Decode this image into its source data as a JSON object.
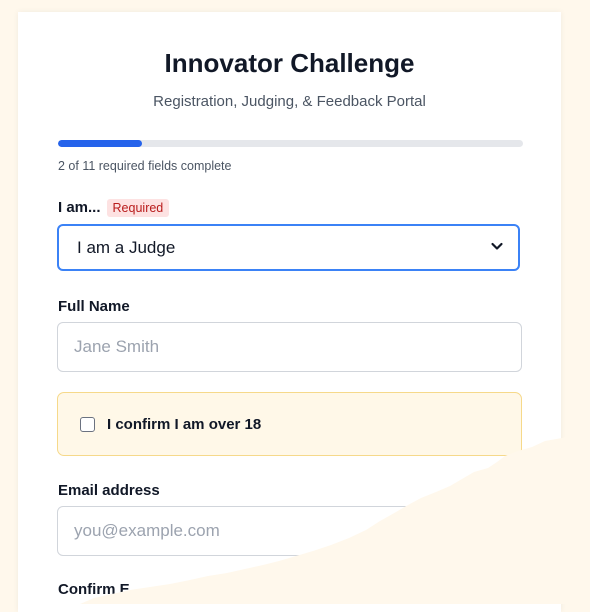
{
  "header": {
    "title": "Innovator Challenge",
    "subtitle": "Registration, Judging, & Feedback Portal"
  },
  "progress": {
    "completed": 2,
    "required_total": 11,
    "fraction": 0.18,
    "text": "2 of 11 required fields complete"
  },
  "role": {
    "label": "I am...",
    "required_badge": "Required",
    "selected_value": "I am a Judge"
  },
  "full_name": {
    "label": "Full Name",
    "placeholder": "Jane Smith"
  },
  "age_confirm": {
    "label": "I confirm I am over 18",
    "checked": false
  },
  "email": {
    "label": "Email address",
    "placeholder": "you@example.com"
  },
  "confirm_email": {
    "label": "Confirm E"
  },
  "colors": {
    "accent": "#2563eb",
    "focus_border": "#3b82f6",
    "badge_bg": "#fde2e2",
    "badge_text": "#b91c1c",
    "confirm_bg": "#fff8e8",
    "confirm_border": "#f6d98a",
    "page_bg": "#fff8ec"
  }
}
